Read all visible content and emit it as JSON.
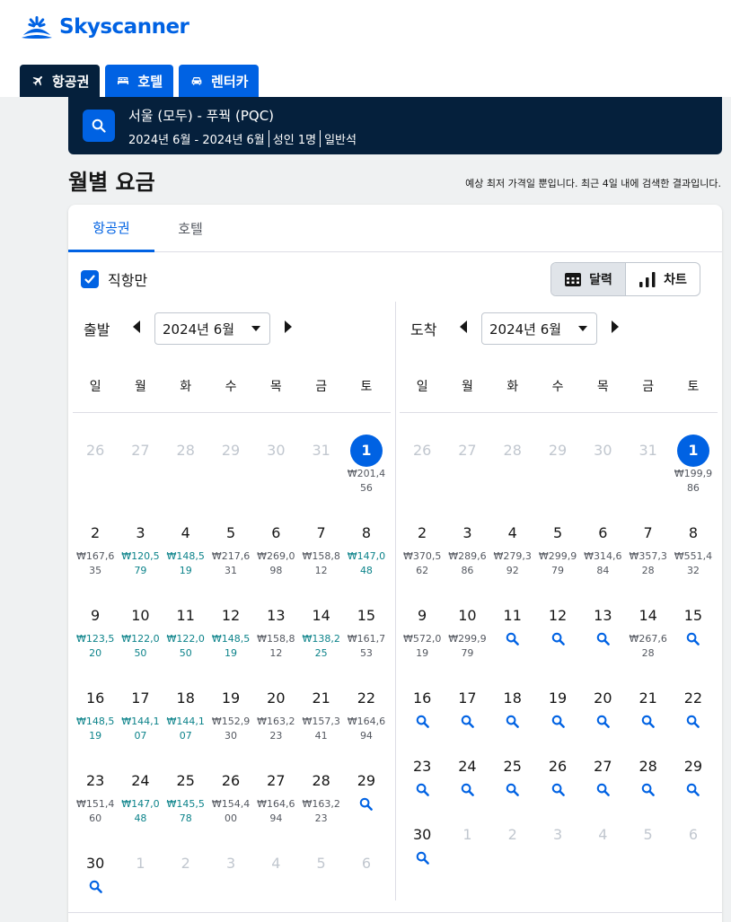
{
  "brand": {
    "name": "Skyscanner",
    "color": "#0062e3"
  },
  "nav": {
    "tabs": [
      {
        "label": "항공권",
        "icon": "plane-icon",
        "active": true
      },
      {
        "label": "호텔",
        "icon": "bed-icon",
        "active": false
      },
      {
        "label": "렌터카",
        "icon": "car-icon",
        "active": false
      }
    ]
  },
  "search": {
    "route": "서울 (모두) - 푸꿕 (PQC)",
    "dates": "2024년 6월 - 2024년 6월",
    "travellers": "성인 1명",
    "cabin": "일반석"
  },
  "page": {
    "title": "월별 요금",
    "disclaimer": "예상 최저 가격일 뿐입니다. 최근 4일 내에 검색한 결과입니다."
  },
  "card": {
    "tabs": [
      {
        "label": "항공권",
        "active": true
      },
      {
        "label": "호텔",
        "active": false
      }
    ],
    "direct_only_label": "직항만",
    "direct_only_checked": true,
    "view": {
      "calendar_label": "달력",
      "chart_label": "차트",
      "active": "calendar"
    }
  },
  "colors": {
    "low_price": "#0c838a",
    "normal_price": "#545860",
    "selected": "#0062e3",
    "muted": "#c1c7cf"
  },
  "weekdays": [
    "일",
    "월",
    "화",
    "수",
    "목",
    "금",
    "토"
  ],
  "calendars": [
    {
      "label": "출발",
      "month": "2024년 6월",
      "days": [
        {
          "d": "26",
          "m": true
        },
        {
          "d": "27",
          "m": true
        },
        {
          "d": "28",
          "m": true
        },
        {
          "d": "29",
          "m": true
        },
        {
          "d": "30",
          "m": true
        },
        {
          "d": "31",
          "m": true
        },
        {
          "d": "1",
          "sel": true,
          "p": "₩201,456"
        },
        {
          "d": "2",
          "p": "₩167,635"
        },
        {
          "d": "3",
          "p": "₩120,579",
          "low": true
        },
        {
          "d": "4",
          "p": "₩148,519",
          "low": true
        },
        {
          "d": "5",
          "p": "₩217,631"
        },
        {
          "d": "6",
          "p": "₩269,098"
        },
        {
          "d": "7",
          "p": "₩158,812"
        },
        {
          "d": "8",
          "p": "₩147,048",
          "low": true
        },
        {
          "d": "9",
          "p": "₩123,520",
          "low": true
        },
        {
          "d": "10",
          "p": "₩122,050",
          "low": true
        },
        {
          "d": "11",
          "p": "₩122,050",
          "low": true
        },
        {
          "d": "12",
          "p": "₩148,519",
          "low": true
        },
        {
          "d": "13",
          "p": "₩158,812"
        },
        {
          "d": "14",
          "p": "₩138,225",
          "low": true
        },
        {
          "d": "15",
          "p": "₩161,753"
        },
        {
          "d": "16",
          "p": "₩148,519",
          "low": true
        },
        {
          "d": "17",
          "p": "₩144,107",
          "low": true
        },
        {
          "d": "18",
          "p": "₩144,107",
          "low": true
        },
        {
          "d": "19",
          "p": "₩152,930"
        },
        {
          "d": "20",
          "p": "₩163,223"
        },
        {
          "d": "21",
          "p": "₩157,341"
        },
        {
          "d": "22",
          "p": "₩164,694"
        },
        {
          "d": "23",
          "p": "₩151,460"
        },
        {
          "d": "24",
          "p": "₩147,048",
          "low": true
        },
        {
          "d": "25",
          "p": "₩145,578",
          "low": true
        },
        {
          "d": "26",
          "p": "₩154,400"
        },
        {
          "d": "27",
          "p": "₩164,694"
        },
        {
          "d": "28",
          "p": "₩163,223"
        },
        {
          "d": "29",
          "s": true
        },
        {
          "d": "30",
          "s": true
        },
        {
          "d": "1",
          "m": true
        },
        {
          "d": "2",
          "m": true
        },
        {
          "d": "3",
          "m": true
        },
        {
          "d": "4",
          "m": true
        },
        {
          "d": "5",
          "m": true
        },
        {
          "d": "6",
          "m": true
        }
      ]
    },
    {
      "label": "도착",
      "month": "2024년 6월",
      "days": [
        {
          "d": "26",
          "m": true
        },
        {
          "d": "27",
          "m": true
        },
        {
          "d": "28",
          "m": true
        },
        {
          "d": "29",
          "m": true
        },
        {
          "d": "30",
          "m": true
        },
        {
          "d": "31",
          "m": true
        },
        {
          "d": "1",
          "sel": true,
          "p": "₩199,986"
        },
        {
          "d": "2",
          "p": "₩370,562"
        },
        {
          "d": "3",
          "p": "₩289,686"
        },
        {
          "d": "4",
          "p": "₩279,392"
        },
        {
          "d": "5",
          "p": "₩299,979"
        },
        {
          "d": "6",
          "p": "₩314,684"
        },
        {
          "d": "7",
          "p": "₩357,328"
        },
        {
          "d": "8",
          "p": "₩551,432"
        },
        {
          "d": "9",
          "p": "₩572,019"
        },
        {
          "d": "10",
          "p": "₩299,979"
        },
        {
          "d": "11",
          "s": true
        },
        {
          "d": "12",
          "s": true
        },
        {
          "d": "13",
          "s": true
        },
        {
          "d": "14",
          "p": "₩267,628"
        },
        {
          "d": "15",
          "s": true
        },
        {
          "d": "16",
          "s": true
        },
        {
          "d": "17",
          "s": true
        },
        {
          "d": "18",
          "s": true
        },
        {
          "d": "19",
          "s": true
        },
        {
          "d": "20",
          "s": true
        },
        {
          "d": "21",
          "s": true
        },
        {
          "d": "22",
          "s": true
        },
        {
          "d": "23",
          "s": true
        },
        {
          "d": "24",
          "s": true
        },
        {
          "d": "25",
          "s": true
        },
        {
          "d": "26",
          "s": true
        },
        {
          "d": "27",
          "s": true
        },
        {
          "d": "28",
          "s": true
        },
        {
          "d": "29",
          "s": true
        },
        {
          "d": "30",
          "s": true
        },
        {
          "d": "1",
          "m": true
        },
        {
          "d": "2",
          "m": true
        },
        {
          "d": "3",
          "m": true
        },
        {
          "d": "4",
          "m": true
        },
        {
          "d": "5",
          "m": true
        },
        {
          "d": "6",
          "m": true
        }
      ]
    }
  ]
}
